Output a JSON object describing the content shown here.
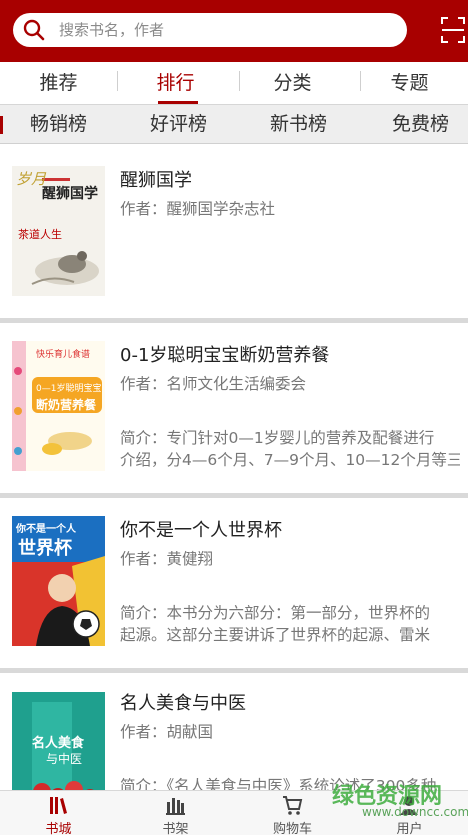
{
  "search": {
    "placeholder": "搜索书名，作者"
  },
  "tabs": [
    {
      "label": "推荐"
    },
    {
      "label": "排行"
    },
    {
      "label": "分类"
    },
    {
      "label": "专题"
    }
  ],
  "subtabs": [
    {
      "label": "畅销榜"
    },
    {
      "label": "好评榜"
    },
    {
      "label": "新书榜"
    },
    {
      "label": "免费榜"
    }
  ],
  "books": [
    {
      "title": "醒狮国学",
      "author": "作者：醒狮国学杂志社",
      "desc1": "",
      "desc2": "",
      "cover": {
        "main": "醒狮国学",
        "side": "岁月",
        "bottom": "茶道人生"
      }
    },
    {
      "title": "0-1岁聪明宝宝断奶营养餐",
      "author": "作者：名师文化生活编委会",
      "desc1": "简介：专门针对0—1岁婴儿的营养及配餐进行",
      "desc2": "介绍，分4—6个月、7—9个月、10—12个月等三",
      "cover": {
        "top": "快乐育儿食谱",
        "main": "0—1岁聪明宝宝",
        "sub": "断奶营养餐"
      }
    },
    {
      "title": "你不是一个人世界杯",
      "author": "作者：黄健翔",
      "desc1": "简介：本书分为六部分：第一部分，世界杯的",
      "desc2": "起源。这部分主要讲诉了世界杯的起源、雷米",
      "cover": {
        "top": "你不是一个人",
        "main": "世界杯"
      }
    },
    {
      "title": "名人美食与中医",
      "author": "作者：胡献国",
      "desc1": "简介：《名人美食与中医》系统论述了300多种",
      "desc2": "",
      "cover": {
        "main": "名人美食",
        "sub": "与中医"
      }
    }
  ],
  "bottom_nav": [
    {
      "label": "书城",
      "icon": "bookstore-icon"
    },
    {
      "label": "书架",
      "icon": "bookshelf-icon"
    },
    {
      "label": "购物车",
      "icon": "cart-icon"
    },
    {
      "label": "用户",
      "icon": "user-icon"
    }
  ],
  "watermark": {
    "main": "绿色资源网",
    "sub": "www.downcc.com"
  },
  "colors": {
    "brand": "#a80000",
    "divider": "#d9d9d9"
  }
}
